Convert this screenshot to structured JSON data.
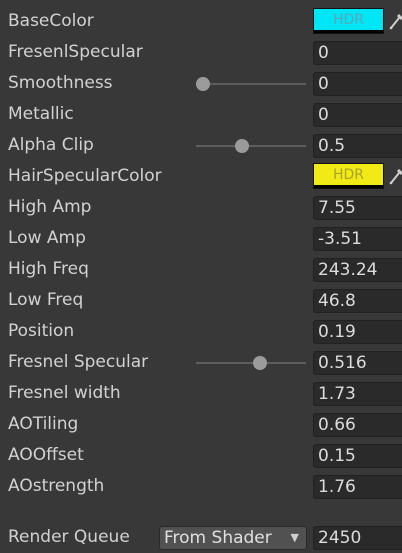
{
  "properties": [
    {
      "label": "BaseColor",
      "type": "color",
      "hdr": "HDR",
      "color": "#00e6f7",
      "text_color": "#5aa7b3"
    },
    {
      "label": "FresenlSpecular",
      "type": "field",
      "value": "0"
    },
    {
      "label": "Smoothness",
      "type": "slider",
      "value": "0",
      "fraction": 0.0
    },
    {
      "label": "Metallic",
      "type": "field",
      "value": "0"
    },
    {
      "label": "Alpha Clip",
      "type": "slider",
      "value": "0.5",
      "fraction": 0.35
    },
    {
      "label": "HairSpecularColor",
      "type": "color",
      "hdr": "HDR",
      "color": "#f2ea15",
      "text_color": "#a9a330"
    },
    {
      "label": "High Amp",
      "type": "field",
      "value": "7.55"
    },
    {
      "label": "Low Amp",
      "type": "field",
      "value": "-3.51"
    },
    {
      "label": "High Freq",
      "type": "field",
      "value": "243.24"
    },
    {
      "label": "Low Freq",
      "type": "field",
      "value": "46.8"
    },
    {
      "label": "Position",
      "type": "field",
      "value": "0.19"
    },
    {
      "label": "Fresnel Specular",
      "type": "slider",
      "value": "0.516",
      "fraction": 0.516
    },
    {
      "label": "Fresnel width",
      "type": "field",
      "value": "1.73"
    },
    {
      "label": "AOTiling",
      "type": "field",
      "value": "0.66"
    },
    {
      "label": "AOOffset",
      "type": "field",
      "value": "0.15"
    },
    {
      "label": "AOstrength",
      "type": "field",
      "value": "1.76"
    }
  ],
  "render_queue": {
    "label": "Render Queue",
    "dropdown_value": "From Shader",
    "value": "2450"
  },
  "icons": {
    "color_picker": "eyedropper-icon",
    "dropdown": "triangle-down-icon"
  }
}
